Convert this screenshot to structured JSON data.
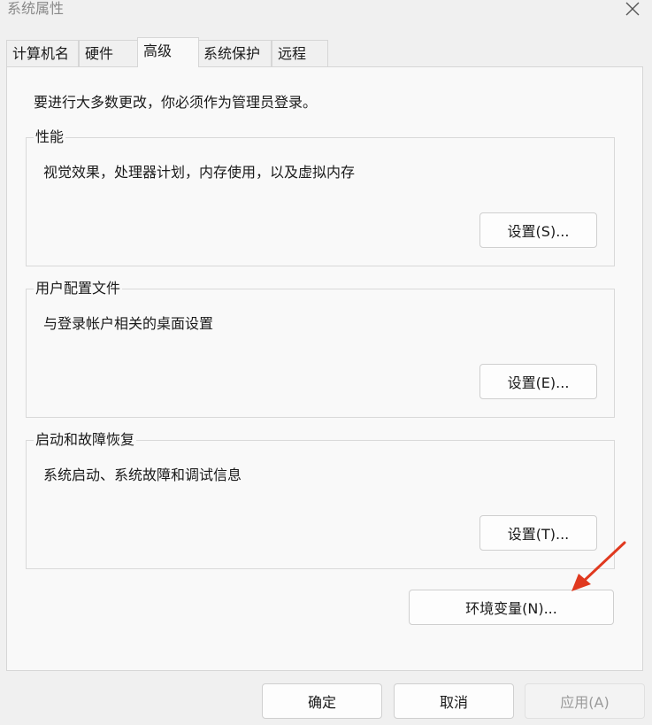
{
  "window": {
    "title": "系统属性"
  },
  "tabs": [
    {
      "label": "计算机名"
    },
    {
      "label": "硬件"
    },
    {
      "label": "高级",
      "active": true
    },
    {
      "label": "系统保护"
    },
    {
      "label": "远程"
    }
  ],
  "main": {
    "admin_note": "要进行大多数更改，你必须作为管理员登录。",
    "groups": [
      {
        "title": "性能",
        "description": "视觉效果，处理器计划，内存使用，以及虚拟内存",
        "button": "设置(S)..."
      },
      {
        "title": "用户配置文件",
        "description": "与登录帐户相关的桌面设置",
        "button": "设置(E)..."
      },
      {
        "title": "启动和故障恢复",
        "description": "系统启动、系统故障和调试信息",
        "button": "设置(T)..."
      }
    ],
    "env_button": "环境变量(N)..."
  },
  "footer": {
    "ok": "确定",
    "cancel": "取消",
    "apply": "应用(A)"
  },
  "icons": {
    "close": "close-icon",
    "annotation": "red-arrow-icon"
  },
  "colors": {
    "annotation_arrow": "#e0391f"
  }
}
